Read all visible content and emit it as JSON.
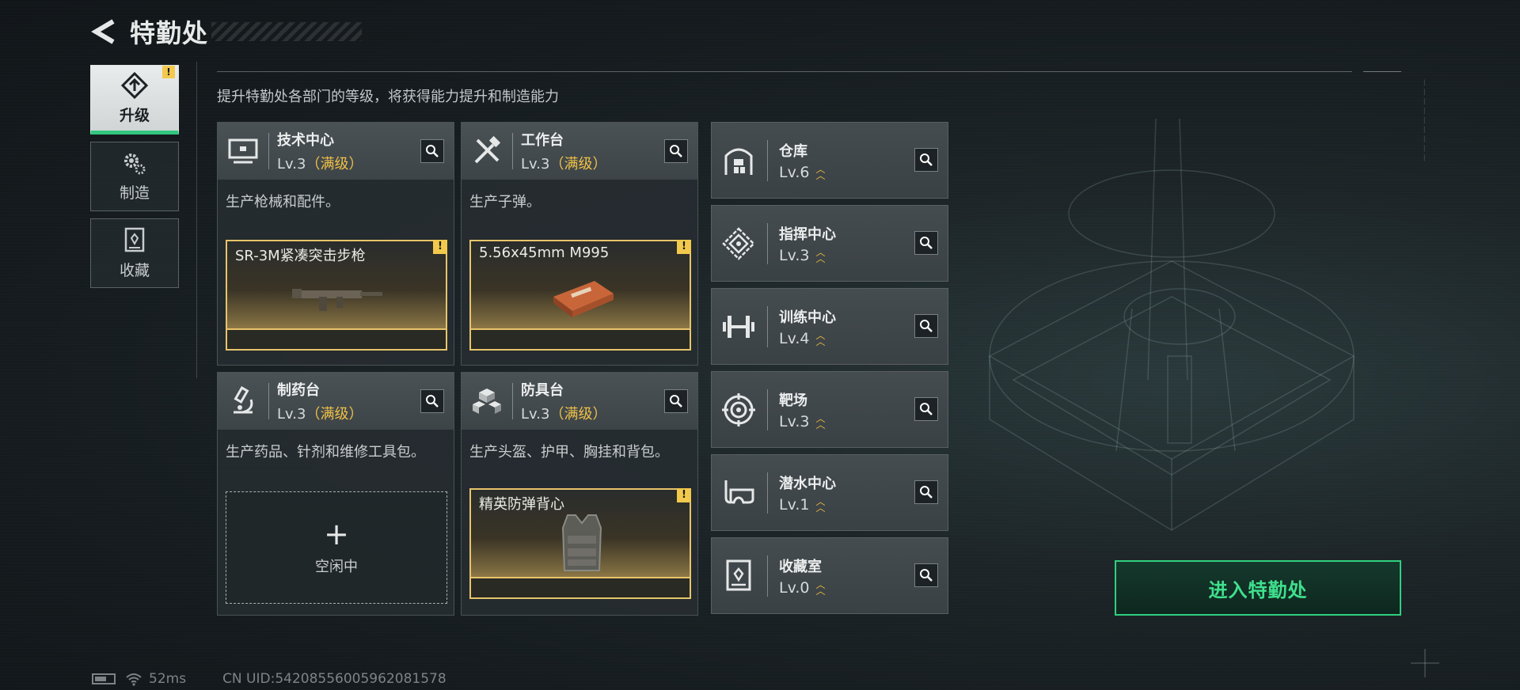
{
  "header": {
    "title": "特勤处"
  },
  "tabs": [
    {
      "label": "升级",
      "icon": "upgrade-icon",
      "active": true,
      "badge": "!"
    },
    {
      "label": "制造",
      "icon": "gears-icon",
      "active": false
    },
    {
      "label": "收藏",
      "icon": "collection-icon",
      "active": false
    }
  ],
  "subtitle": "提升特勤处各部门的等级，将获得能力提升和制造能力",
  "cards": [
    {
      "name": "技术中心",
      "level": "Lv.3",
      "max": "（满级）",
      "desc": "生产枪械和配件。",
      "product": "SR-3M紧凑突击步枪",
      "badge": "!"
    },
    {
      "name": "工作台",
      "level": "Lv.3",
      "max": "（满级）",
      "desc": "生产子弹。",
      "product": "5.56x45mm M995",
      "badge": "!"
    },
    {
      "name": "制药台",
      "level": "Lv.3",
      "max": "（满级）",
      "desc": "生产药品、针剂和维修工具包。",
      "idle": "空闲中"
    },
    {
      "name": "防具台",
      "level": "Lv.3",
      "max": "（满级）",
      "desc": "生产头盔、护甲、胸挂和背包。",
      "product": "精英防弹背心",
      "badge": "!"
    }
  ],
  "facilities": [
    {
      "name": "仓库",
      "level": "Lv.6"
    },
    {
      "name": "指挥中心",
      "level": "Lv.3"
    },
    {
      "name": "训练中心",
      "level": "Lv.4"
    },
    {
      "name": "靶场",
      "level": "Lv.3"
    },
    {
      "name": "潜水中心",
      "level": "Lv.1"
    },
    {
      "name": "收藏室",
      "level": "Lv.0"
    }
  ],
  "enter_button": "进入特勤处",
  "status": {
    "ping": "52ms",
    "uid": "CN UID:54208556005962081578"
  },
  "colors": {
    "accent_green": "#2fd07f",
    "gold": "#f0c046",
    "badge_yellow": "#f2c94c"
  }
}
